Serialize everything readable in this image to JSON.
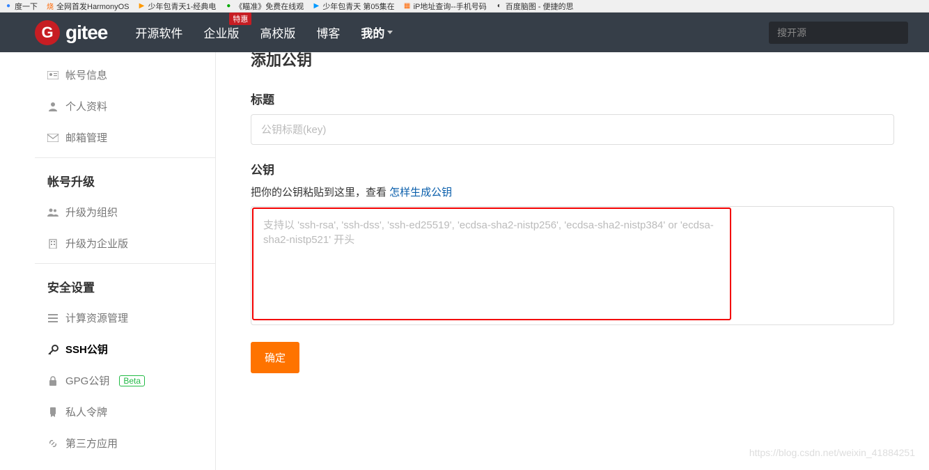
{
  "browser_tabs": [
    {
      "label": "度一下",
      "icon_color": "#3385ff"
    },
    {
      "label": "全网首发HarmonyOS",
      "icon_color": "#ff6600",
      "icon_char": "烧"
    },
    {
      "label": "少年包青天1-经典电",
      "icon_color": "#ff9900",
      "icon_char": "▶"
    },
    {
      "label": "《瞄准》免费在线观",
      "icon_color": "#00aa00",
      "icon_char": "●"
    },
    {
      "label": "少年包青天 第05集在",
      "icon_color": "#0099ff",
      "icon_char": "▶"
    },
    {
      "label": "iP地址查询--手机号码",
      "icon_color": "#ff6600",
      "icon_char": "▦"
    },
    {
      "label": "百度脑图 - 便捷的思",
      "icon_color": "#333",
      "icon_char": "◐"
    }
  ],
  "header": {
    "logo_char": "G",
    "logo_text": "gitee",
    "nav": [
      {
        "label": "开源软件"
      },
      {
        "label": "企业版",
        "badge": "特惠"
      },
      {
        "label": "高校版"
      },
      {
        "label": "博客"
      },
      {
        "label": "我的",
        "my": true
      }
    ],
    "search_placeholder": "搜开源"
  },
  "sidebar": {
    "items_top": [
      {
        "label": "帐号信息",
        "icon": "id"
      },
      {
        "label": "个人资料",
        "icon": "user"
      },
      {
        "label": "邮箱管理",
        "icon": "mail"
      }
    ],
    "heading_upgrade": "帐号升级",
    "items_upgrade": [
      {
        "label": "升级为组织",
        "icon": "org"
      },
      {
        "label": "升级为企业版",
        "icon": "building"
      }
    ],
    "heading_security": "安全设置",
    "items_security": [
      {
        "label": "计算资源管理",
        "icon": "bars"
      },
      {
        "label": "SSH公钥",
        "icon": "key",
        "active": true
      },
      {
        "label": "GPG公钥",
        "icon": "lock",
        "beta": "Beta"
      },
      {
        "label": "私人令牌",
        "icon": "badge"
      },
      {
        "label": "第三方应用",
        "icon": "link"
      }
    ]
  },
  "main": {
    "page_title_partial": "添加公钥",
    "title_label": "标题",
    "title_placeholder": "公钥标题(key)",
    "key_label": "公钥",
    "key_hint_prefix": "把你的公钥粘贴到这里，查看 ",
    "key_hint_link": "怎样生成公钥",
    "key_placeholder": "支持以 'ssh-rsa', 'ssh-dss', 'ssh-ed25519', 'ecdsa-sha2-nistp256', 'ecdsa-sha2-nistp384' or 'ecdsa-sha2-nistp521' 开头",
    "submit_label": "确定"
  },
  "watermark": "https://blog.csdn.net/weixin_41884251"
}
